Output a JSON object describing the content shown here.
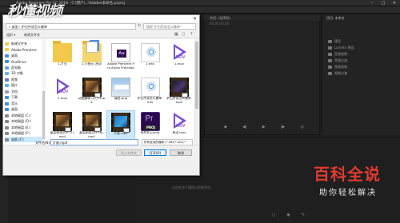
{
  "app": {
    "title": "Adobe Premiere Pro CC 2018 - C:\\用户\\...\\Adobe\\未命名.prproj",
    "monitor_tab": "节目: (无序列)",
    "right_tab": "项目: 未命名",
    "tree_items": [
      "预设",
      "Lumetri 预设",
      "音频效果",
      "音频过渡",
      "视频效果",
      "视频过渡"
    ],
    "timeline_message": "在此处放下媒体以创建序列。",
    "timecode": "00;00;00;00"
  },
  "dialog": {
    "address": "« 桌面 › 护石传说怎么撤单",
    "search_placeholder": "搜索\"护石传说怎么撤单\"",
    "commands": [
      "组织 ▾",
      "新建文件夹"
    ],
    "nav_items": [
      {
        "label": "新建文件夹",
        "icon": "folder-icon",
        "color": "#f2c94c"
      },
      {
        "label": "Adobe Premiere",
        "icon": "folder-icon",
        "color": "#f2c94c"
      },
      {
        "label": "桌面",
        "icon": "desktop-icon",
        "color": "#3d8ee0"
      },
      {
        "label": "OneDrive",
        "icon": "cloud-icon",
        "color": "#3d8ee0"
      },
      {
        "label": "此电脑",
        "icon": "computer-icon",
        "color": "#5aa0e8"
      },
      {
        "label": "3D 对象",
        "icon": "cube-icon",
        "color": "#6bb0f0"
      },
      {
        "label": "视频",
        "icon": "video-icon",
        "color": "#5a7ad0"
      },
      {
        "label": "图片",
        "icon": "picture-icon",
        "color": "#5ab0e0"
      },
      {
        "label": "文档",
        "icon": "document-icon",
        "color": "#8aa0b8"
      },
      {
        "label": "下载",
        "icon": "download-icon",
        "color": "#3d8ee0"
      },
      {
        "label": "音乐",
        "icon": "music-icon",
        "color": "#3d8ee0"
      },
      {
        "label": "桌面",
        "icon": "desktop-icon",
        "color": "#3d8ee0"
      },
      {
        "label": "本地磁盘 (C:)",
        "icon": "drive-icon",
        "color": "#888888"
      },
      {
        "label": "本地磁盘 (D:)",
        "icon": "drive-icon",
        "color": "#888888"
      },
      {
        "label": "本地磁盘 (E:)",
        "icon": "drive-icon",
        "color": "#888888"
      },
      {
        "label": "本地磁盘 (F:)",
        "icon": "drive-icon",
        "color": "#888888"
      },
      {
        "label": "苗颜 (F:)",
        "icon": "drive-icon",
        "color": "#888888"
      }
    ],
    "files": [
      {
        "label": "1-片头",
        "type": "folder"
      },
      {
        "label": "2-小图示_启动",
        "type": "folder-docs"
      },
      {
        "label": "Adobe Premiere Pro Audio Previews",
        "type": "folder-audio"
      },
      {
        "label": "1.mts",
        "type": "media"
      },
      {
        "label": "1.mov",
        "type": "mov"
      },
      {
        "label": "2.mov",
        "type": "mov"
      },
      {
        "label": "动图编辑 (2)_1.mp4",
        "type": "film"
      },
      {
        "label": "痛经.png",
        "type": "image"
      },
      {
        "label": "护石传说怎么撤单.mts",
        "type": "media"
      },
      {
        "label": "护石传说怎么撤单.mp4",
        "type": "film-night"
      },
      {
        "label": "晶莹剔透文件 (7).mp4",
        "type": "film"
      },
      {
        "label": "晶莹剔透文件 (8).mp4",
        "type": "film"
      },
      {
        "label": "片尾.mp4",
        "type": "film-blue"
      },
      {
        "label": "未命名.prproj",
        "type": "prproj"
      },
      {
        "label": "启动.mov",
        "type": "mov"
      }
    ],
    "selected_file_index": 12,
    "filename_label": "文件名(N):",
    "filename_value": "片尾.mp4",
    "filter_value": "所有支持的媒体 (*.264;*.3G2;*",
    "btn_import_folder": "导入文件夹",
    "btn_open": "打开(O)",
    "btn_cancel": "取消"
  },
  "watermark": {
    "top_text": "秒懂视频",
    "big_text": "百科全说",
    "small_text": "助你轻松解决"
  },
  "colors": {
    "accent": "#0078d7",
    "watermark_red": "#e23b2e",
    "folder_yellow": "#f2c94c",
    "mov_purple": "#7b4fd1"
  }
}
